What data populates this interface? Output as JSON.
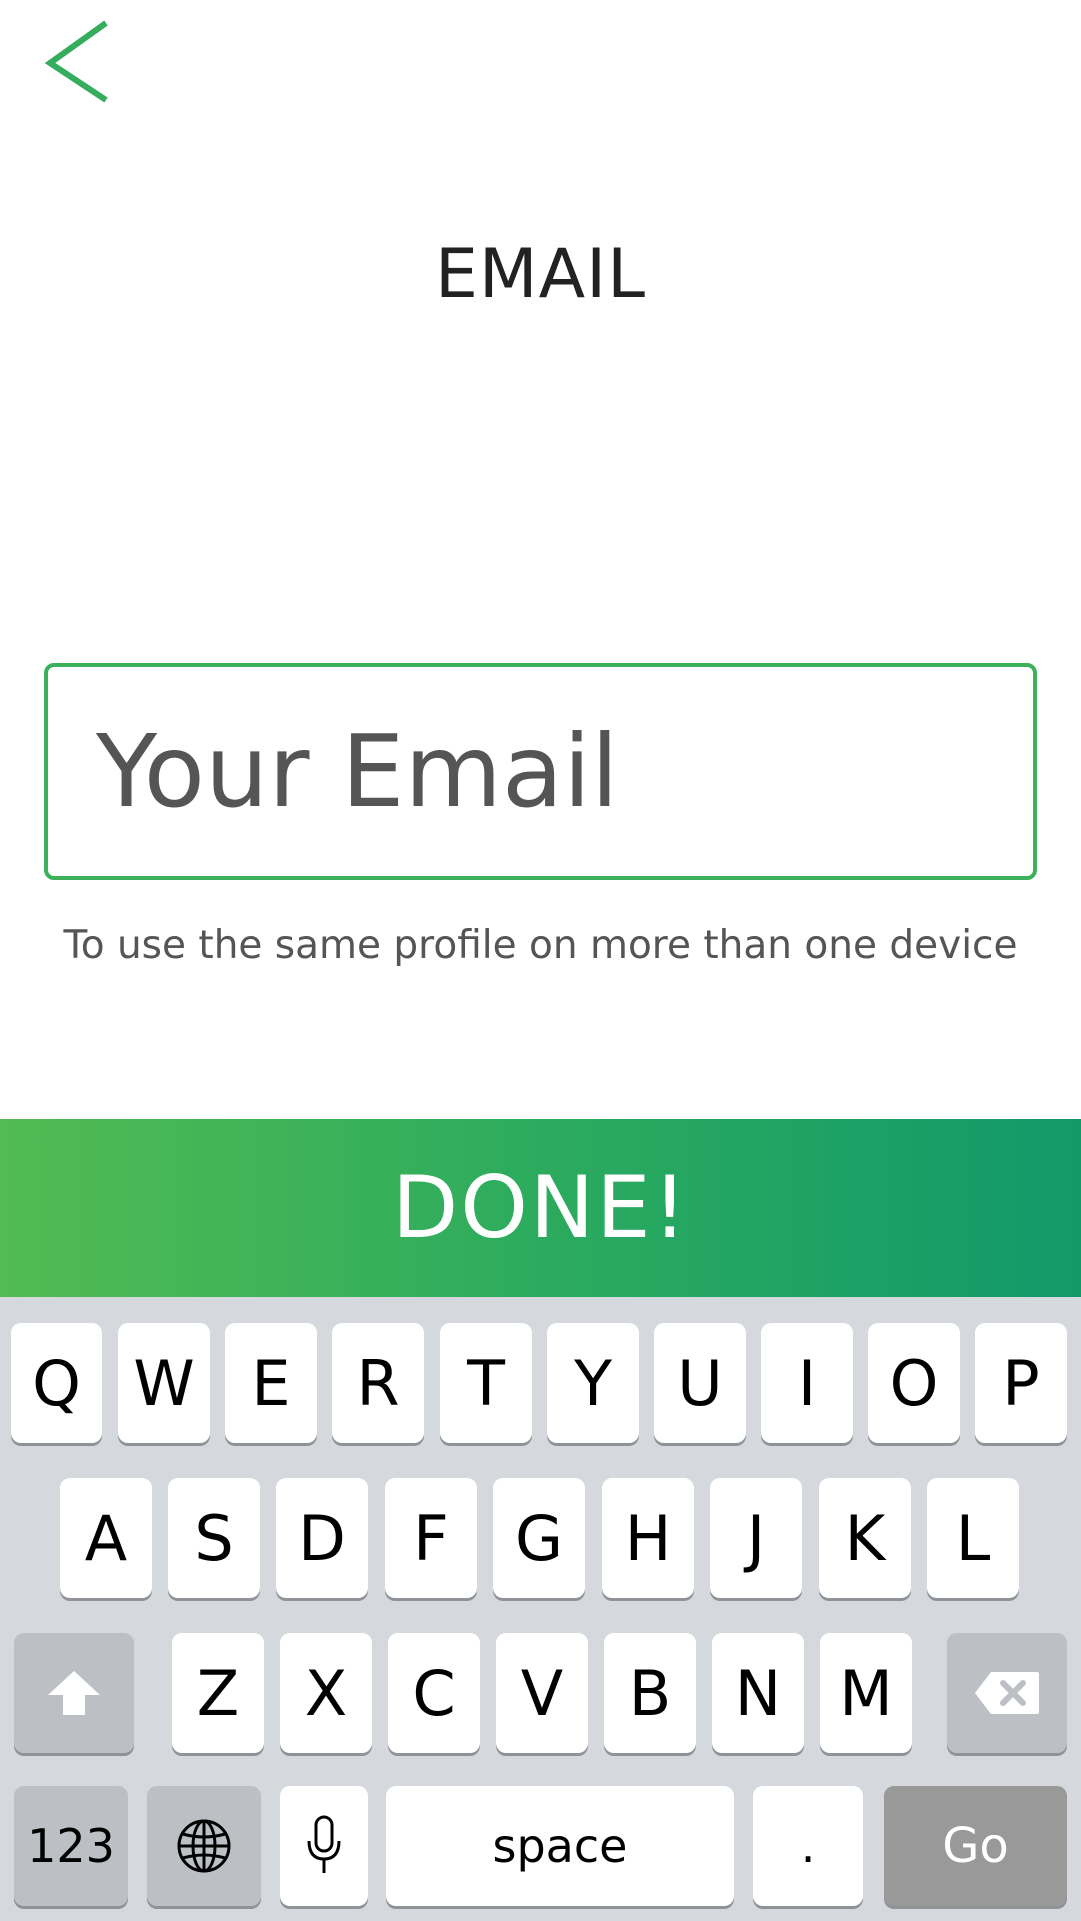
{
  "header": {
    "back_icon": "chevron-left-icon",
    "title": "EMAIL"
  },
  "form": {
    "email_value": "",
    "email_placeholder": "Your Email",
    "helper_text": "To use the same profile on more than one device"
  },
  "actions": {
    "done_label": "DONE!"
  },
  "keyboard": {
    "row1": [
      "Q",
      "W",
      "E",
      "R",
      "T",
      "Y",
      "U",
      "I",
      "O",
      "P"
    ],
    "row2": [
      "A",
      "S",
      "D",
      "F",
      "G",
      "H",
      "J",
      "K",
      "L"
    ],
    "row3": [
      "Z",
      "X",
      "C",
      "V",
      "B",
      "N",
      "M"
    ],
    "shift_icon": "shift-arrow-icon",
    "backspace_icon": "backspace-icon",
    "numbers_label": "123",
    "globe_icon": "globe-icon",
    "mic_icon": "microphone-icon",
    "space_label": "space",
    "period_label": ".",
    "go_label": "Go"
  },
  "colors": {
    "accent_green": "#3cb05a",
    "done_gradient_start": "#52bb52",
    "done_gradient_end": "#12996a",
    "keyboard_background": "#d5d8dc",
    "go_key": "#999999"
  }
}
